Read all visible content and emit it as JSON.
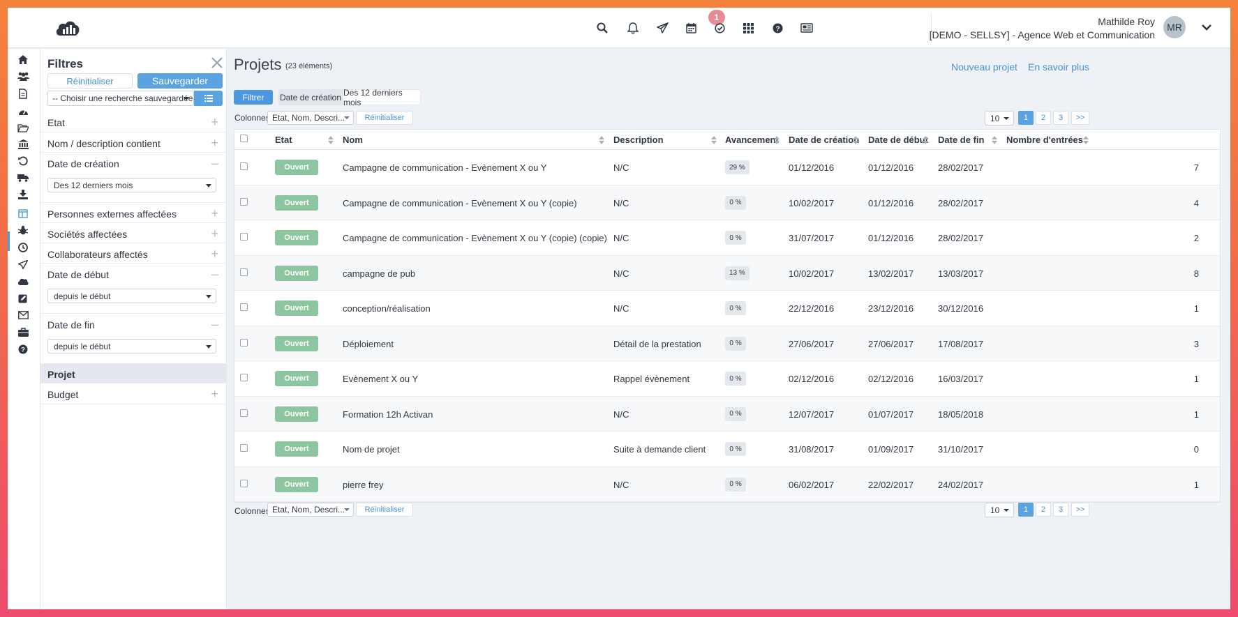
{
  "topbar": {
    "notification_count": "1",
    "user_name": "Mathilde Roy",
    "company": "[DEMO - SELLSY] - Agence Web et Communication",
    "avatar_initials": "MR"
  },
  "filters": {
    "title": "Filtres",
    "reset_label": "Réinitialiser",
    "save_label": "Sauvegarder",
    "saved_search": "-- Choisir une recherche sauvegardée --",
    "rows": {
      "etat": "Etat",
      "nom": "Nom / description contient",
      "date_creation": "Date de création",
      "date_creation_value": "Des 12 derniers mois",
      "personnes": "Personnes externes affectées",
      "societes": "Sociétés affectées",
      "collaborateurs": "Collaborateurs affectés",
      "date_debut": "Date de début",
      "date_debut_value": "depuis le début",
      "date_fin": "Date de fin",
      "date_fin_value": "depuis le début",
      "projet": "Projet",
      "budget": "Budget"
    }
  },
  "main": {
    "title": "Projets",
    "count": "(23 éléments)",
    "new_project": "Nouveau projet",
    "learn_more": "En savoir plus",
    "filter_button": "Filtrer",
    "active_filter_key": "Date de création",
    "active_filter_value": "Des 12 derniers mois",
    "columns_label": "Colonnes",
    "columns_value": "Etat, Nom, Descri...",
    "columns_reset": "Réinitialiser",
    "per_page": "10",
    "pages": [
      "1",
      "2",
      "3",
      ">>"
    ]
  },
  "table": {
    "headers": [
      "Etat",
      "Nom",
      "Description",
      "Avancement",
      "Date de création",
      "Date de début",
      "Date de fin",
      "Nombre d'entrées"
    ],
    "rows": [
      {
        "status": "Ouvert",
        "name": "Campagne de communication - Evènement X ou Y",
        "description": "N/C",
        "progress": "29 %",
        "created": "01/12/2016",
        "start": "01/12/2016",
        "end": "28/02/2017",
        "entries": "7"
      },
      {
        "status": "Ouvert",
        "name": "Campagne de communication - Evènement X ou Y (copie)",
        "description": "N/C",
        "progress": "0 %",
        "created": "10/02/2017",
        "start": "01/12/2016",
        "end": "28/02/2017",
        "entries": "4"
      },
      {
        "status": "Ouvert",
        "name": "Campagne de communication - Evènement X ou Y (copie) (copie)",
        "description": "N/C",
        "progress": "0 %",
        "created": "31/07/2017",
        "start": "01/12/2016",
        "end": "28/02/2017",
        "entries": "2"
      },
      {
        "status": "Ouvert",
        "name": "campagne de pub",
        "description": "N/C",
        "progress": "13 %",
        "created": "10/02/2017",
        "start": "13/02/2017",
        "end": "13/03/2017",
        "entries": "8"
      },
      {
        "status": "Ouvert",
        "name": "conception/réalisation",
        "description": "N/C",
        "progress": "0 %",
        "created": "22/12/2016",
        "start": "23/12/2016",
        "end": "30/12/2016",
        "entries": "1"
      },
      {
        "status": "Ouvert",
        "name": "Déploiement",
        "description": "Détail de la prestation",
        "progress": "0 %",
        "created": "27/06/2017",
        "start": "27/06/2017",
        "end": "17/08/2017",
        "entries": "3"
      },
      {
        "status": "Ouvert",
        "name": "Evènement X ou Y",
        "description": "Rappel évènement",
        "progress": "0 %",
        "created": "02/12/2016",
        "start": "02/12/2016",
        "end": "16/03/2017",
        "entries": "1"
      },
      {
        "status": "Ouvert",
        "name": "Formation 12h Activan",
        "description": "N/C",
        "progress": "0 %",
        "created": "12/07/2017",
        "start": "01/07/2017",
        "end": "18/05/2018",
        "entries": "1"
      },
      {
        "status": "Ouvert",
        "name": "Nom de projet",
        "description": "Suite à demande client",
        "progress": "0 %",
        "created": "31/08/2017",
        "start": "01/09/2017",
        "end": "31/10/2017",
        "entries": "0"
      },
      {
        "status": "Ouvert",
        "name": "pierre frey",
        "description": "N/C",
        "progress": "0 %",
        "created": "06/02/2017",
        "start": "22/02/2017",
        "end": "24/02/2017",
        "entries": "1"
      }
    ]
  },
  "colors": {
    "accent": "#5aa2e0",
    "status_open": "#8cc5a0",
    "notification": "#e58d93"
  }
}
